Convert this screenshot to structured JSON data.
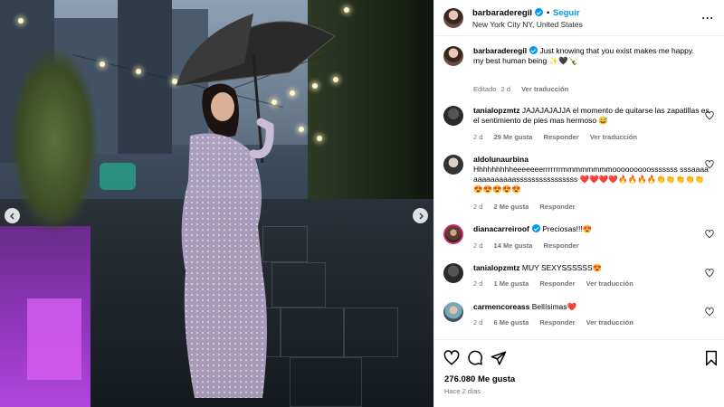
{
  "post": {
    "username": "barbaraderegil",
    "follow_label": "Seguir",
    "separator": "•",
    "location": "New York City NY, United States",
    "more_glyph": "···"
  },
  "caption": {
    "username": "barbaraderegil",
    "text_line1": "Just knowing that you exist makes me happy.",
    "text_line2": "my best human being ✨🖤🍾",
    "edited": "Editado",
    "time": "2 d",
    "translate": "Ver traducción"
  },
  "comments": [
    {
      "username": "tanialopzmtz",
      "text": "JAJAJAJAJJA el momento de quitarse las zapatillas es el sentimiento de pies mas hermoso 😅",
      "time": "2 d",
      "likes": "29 Me gusta",
      "reply": "Responder",
      "translate": "Ver traducción"
    },
    {
      "username": "aldolunaurbina",
      "text": "Hhhhhhhhheeeeeeerrrrrrrmmmmmmmmooooooooosssssss sssaaaaaaaaaaaaaassssssssssssssss ❤️❤️❤️❤️🔥🔥🔥🔥👏👏👏👏👏😍😍😍😍😍",
      "time": "2 d",
      "likes": "2 Me gusta",
      "reply": "Responder"
    },
    {
      "username": "dianacarreiroof",
      "text": "Preciosas!!!😍",
      "time": "2 d",
      "likes": "14 Me gusta",
      "reply": "Responder"
    },
    {
      "username": "tanialopzmtz",
      "text": "MUY SEXYSSSSSS😍",
      "time": "2 d",
      "likes": "1 Me gusta",
      "reply": "Responder",
      "translate": "Ver traducción"
    },
    {
      "username": "carmencoreass",
      "text": "Bellísimas❤️",
      "time": "2 d",
      "likes": "6 Me gusta",
      "reply": "Responder",
      "translate": "Ver traducción"
    }
  ],
  "footer": {
    "likes": "276.080 Me gusta",
    "ago": "Hace 2 días"
  },
  "colors": {
    "accent": "#0095f6",
    "muted": "#737373",
    "heart_red": "#ed4956"
  },
  "icons": [
    "heart-icon",
    "comment-icon",
    "share-icon",
    "bookmark-icon",
    "more-icon",
    "verified-icon",
    "chevron-left-icon",
    "chevron-right-icon"
  ]
}
